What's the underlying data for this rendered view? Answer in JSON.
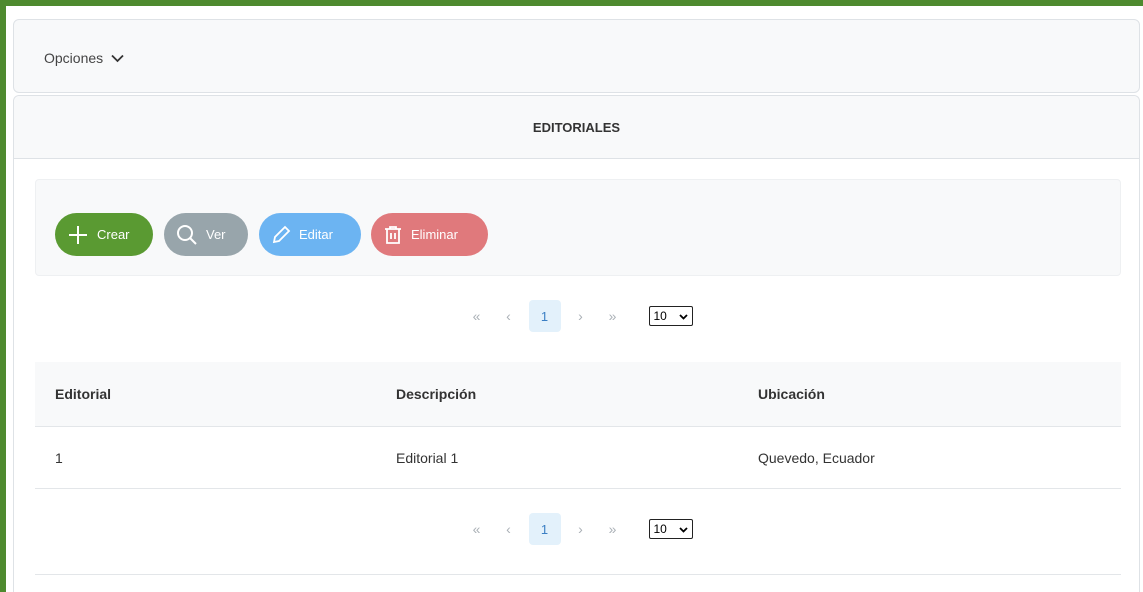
{
  "menu": {
    "options_label": "Opciones"
  },
  "panel": {
    "title": "EDITORIALES"
  },
  "toolbar": {
    "create_label": "Crear",
    "view_label": "Ver",
    "edit_label": "Editar",
    "delete_label": "Eliminar"
  },
  "pagination": {
    "first": "«",
    "prev": "‹",
    "current_page": "1",
    "next": "›",
    "last": "»",
    "rows_per_page": "10"
  },
  "table": {
    "headers": [
      "Editorial",
      "Descripción",
      "Ubicación"
    ],
    "rows": [
      [
        "1",
        "Editorial 1",
        "Quevedo, Ecuador"
      ]
    ]
  },
  "colors": {
    "frame": "#4e8a2f",
    "create": "#5a9a32",
    "view": "#98a5ab",
    "edit": "#6cb4f2",
    "delete": "#e0797c"
  }
}
